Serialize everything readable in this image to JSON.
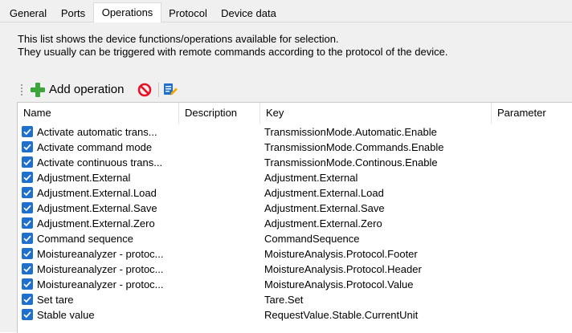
{
  "tabs": [
    {
      "label": "General",
      "active": false
    },
    {
      "label": "Ports",
      "active": false
    },
    {
      "label": "Operations",
      "active": true
    },
    {
      "label": "Protocol",
      "active": false
    },
    {
      "label": "Device data",
      "active": false
    }
  ],
  "description": {
    "line1": "This list shows the device functions/operations available for selection.",
    "line2": "They usually can be triggered with remote commands according to the protocol of the device."
  },
  "toolbar": {
    "add_label": "Add operation",
    "icons": [
      "add-icon",
      "remove-icon",
      "edit-icon"
    ],
    "colors": {
      "add": "#3da53a",
      "remove": "#e81123",
      "edit_doc": "#1f6fce",
      "edit_pencil": "#f2a900"
    }
  },
  "table": {
    "columns": [
      "Name",
      "Description",
      "Key",
      "Parameter"
    ],
    "checkbox_color": "#1f6fce",
    "rows": [
      {
        "checked": true,
        "name": "Activate automatic trans...",
        "description": "",
        "key": "TransmissionMode.Automatic.Enable",
        "parameter": ""
      },
      {
        "checked": true,
        "name": "Activate command mode",
        "description": "",
        "key": "TransmissionMode.Commands.Enable",
        "parameter": ""
      },
      {
        "checked": true,
        "name": "Activate continuous trans...",
        "description": "",
        "key": "TransmissionMode.Continous.Enable",
        "parameter": ""
      },
      {
        "checked": true,
        "name": "Adjustment.External",
        "description": "",
        "key": "Adjustment.External",
        "parameter": ""
      },
      {
        "checked": true,
        "name": "Adjustment.External.Load",
        "description": "",
        "key": "Adjustment.External.Load",
        "parameter": ""
      },
      {
        "checked": true,
        "name": "Adjustment.External.Save",
        "description": "",
        "key": "Adjustment.External.Save",
        "parameter": ""
      },
      {
        "checked": true,
        "name": "Adjustment.External.Zero",
        "description": "",
        "key": "Adjustment.External.Zero",
        "parameter": ""
      },
      {
        "checked": true,
        "name": "Command sequence",
        "description": "",
        "key": "CommandSequence",
        "parameter": ""
      },
      {
        "checked": true,
        "name": "Moistureanalyzer - protoc...",
        "description": "",
        "key": "MoistureAnalysis.Protocol.Footer",
        "parameter": ""
      },
      {
        "checked": true,
        "name": "Moistureanalyzer - protoc...",
        "description": "",
        "key": "MoistureAnalysis.Protocol.Header",
        "parameter": ""
      },
      {
        "checked": true,
        "name": "Moistureanalyzer - protoc...",
        "description": "",
        "key": "MoistureAnalysis.Protocol.Value",
        "parameter": ""
      },
      {
        "checked": true,
        "name": "Set tare",
        "description": "",
        "key": "Tare.Set",
        "parameter": ""
      },
      {
        "checked": true,
        "name": "Stable value",
        "description": "",
        "key": "RequestValue.Stable.CurrentUnit",
        "parameter": ""
      }
    ]
  }
}
